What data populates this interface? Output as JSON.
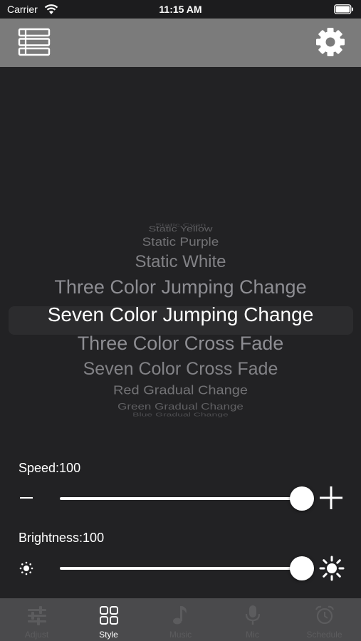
{
  "status_bar": {
    "carrier": "Carrier",
    "time": "11:15 AM"
  },
  "header": {
    "menu_icon": "list-icon",
    "settings_icon": "gear-icon",
    "background": "#7b7b7b"
  },
  "picker": {
    "items": [
      "Static Cyan",
      "Static Yellow",
      "Static Purple",
      "Static White",
      "Three Color Jumping Change",
      "Seven Color Jumping Change",
      "Three Color Cross Fade",
      "Seven Color Cross Fade",
      "Red Gradual Change",
      "Green Gradual Change",
      "Blue Gradual Change"
    ],
    "selected": "Seven Color Jumping Change"
  },
  "speed": {
    "label": "Speed:100",
    "value": 100,
    "max": 100
  },
  "brightness": {
    "label": "Brightness:100",
    "value": 100,
    "max": 100
  },
  "tabs": [
    {
      "label": "Adjust",
      "icon": "sliders-icon",
      "active": false
    },
    {
      "label": "Style",
      "icon": "grid-icon",
      "active": true
    },
    {
      "label": "Music",
      "icon": "music-note-icon",
      "active": false
    },
    {
      "label": "Mic",
      "icon": "microphone-icon",
      "active": false
    },
    {
      "label": "Schedule",
      "icon": "alarm-clock-icon",
      "active": false
    }
  ]
}
